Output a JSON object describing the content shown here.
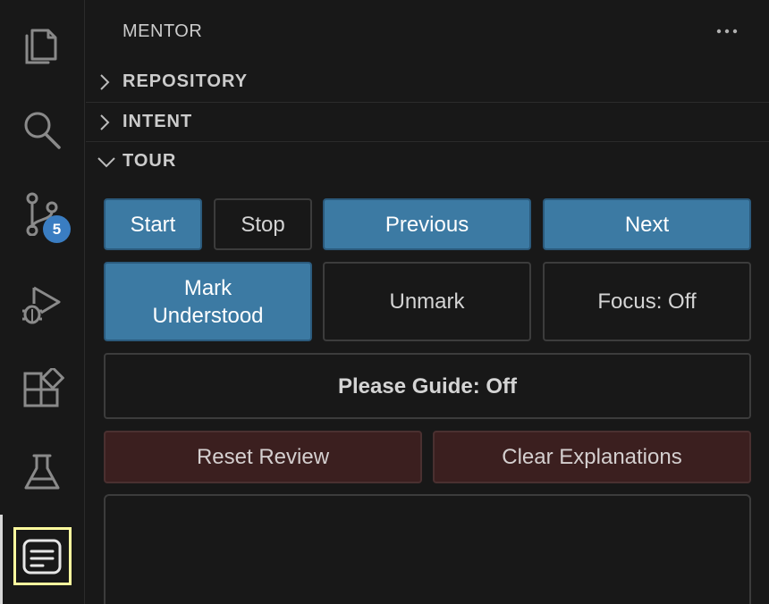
{
  "activity_bar": {
    "items": [
      {
        "icon": "explorer-icon"
      },
      {
        "icon": "search-icon"
      },
      {
        "icon": "source-control-icon",
        "badge": "5"
      },
      {
        "icon": "run-debug-icon"
      },
      {
        "icon": "extensions-icon"
      },
      {
        "icon": "testing-icon"
      },
      {
        "icon": "mentor-icon",
        "active": true
      }
    ],
    "badge_color": "#3a7dc2",
    "focus_color": "#fffb9e"
  },
  "sidebar": {
    "title": "MENTOR",
    "sections": [
      {
        "label": "REPOSITORY",
        "expanded": false
      },
      {
        "label": "INTENT",
        "expanded": false
      },
      {
        "label": "TOUR",
        "expanded": true
      }
    ]
  },
  "tour": {
    "start": "Start",
    "stop": "Stop",
    "previous": "Previous",
    "next": "Next",
    "mark_line1": "Mark",
    "mark_line2": "Understood",
    "unmark": "Unmark",
    "focus": "Focus: Off",
    "please_guide": "Please Guide: Off",
    "reset_review": "Reset Review",
    "clear_explanations": "Clear Explanations"
  },
  "colors": {
    "primary": "#3c7aa3",
    "danger": "#3b1f1f",
    "background": "#181818"
  }
}
